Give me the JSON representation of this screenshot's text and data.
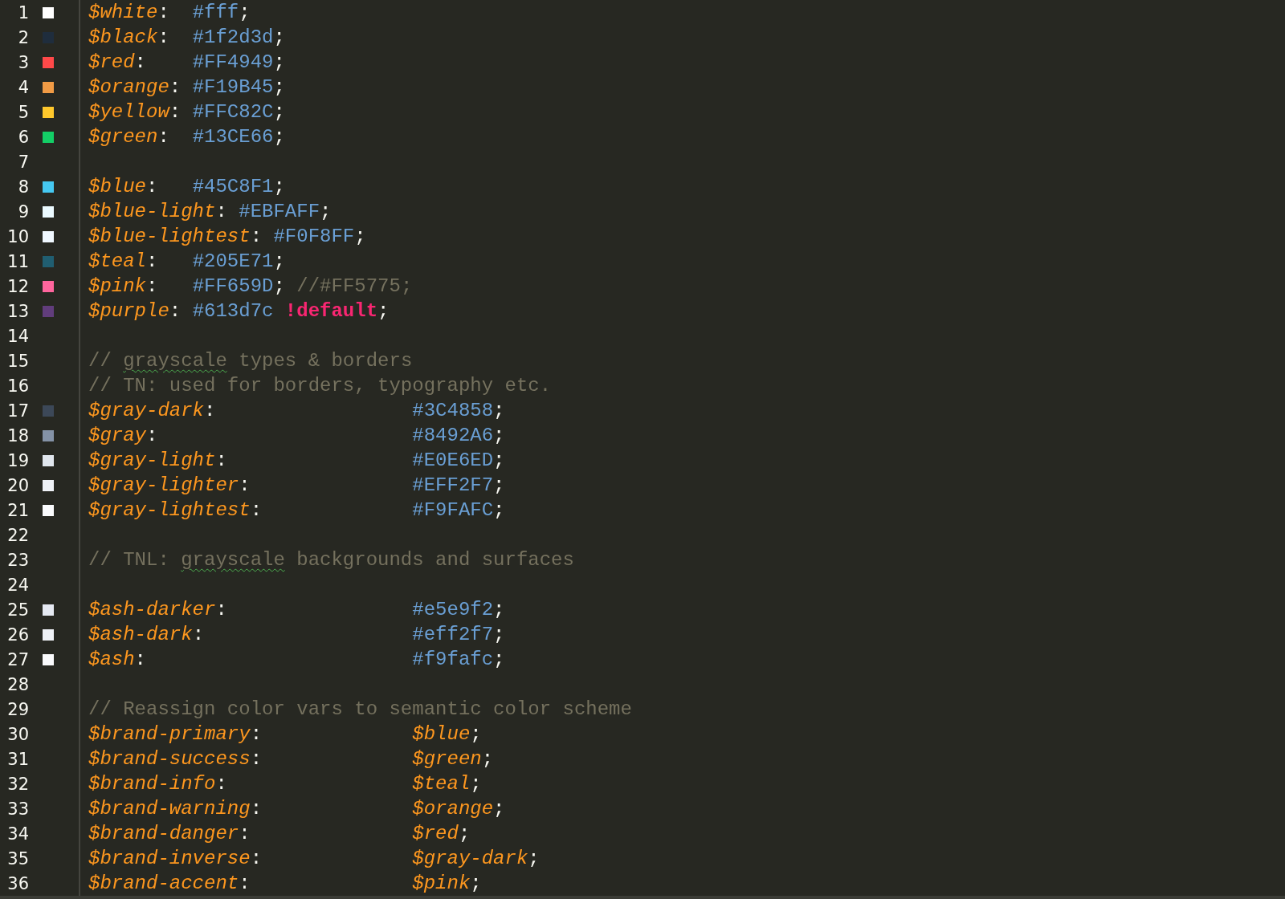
{
  "lines": [
    {
      "number": "1",
      "color": "#ffffff",
      "tokens": [
        {
          "kind": "var",
          "text": "$white"
        },
        {
          "kind": "punct",
          "text": ":  "
        },
        {
          "kind": "value",
          "text": "#fff"
        },
        {
          "kind": "punct",
          "text": ";"
        }
      ]
    },
    {
      "number": "2",
      "color": "#1f2d3d",
      "tokens": [
        {
          "kind": "var",
          "text": "$black"
        },
        {
          "kind": "punct",
          "text": ":  "
        },
        {
          "kind": "value",
          "text": "#1f2d3d"
        },
        {
          "kind": "punct",
          "text": ";"
        }
      ]
    },
    {
      "number": "3",
      "color": "#ff4949",
      "tokens": [
        {
          "kind": "var",
          "text": "$red"
        },
        {
          "kind": "punct",
          "text": ":    "
        },
        {
          "kind": "value",
          "text": "#FF4949"
        },
        {
          "kind": "punct",
          "text": ";"
        }
      ]
    },
    {
      "number": "4",
      "color": "#f19b45",
      "tokens": [
        {
          "kind": "var",
          "text": "$orange"
        },
        {
          "kind": "punct",
          "text": ": "
        },
        {
          "kind": "value",
          "text": "#F19B45"
        },
        {
          "kind": "punct",
          "text": ";"
        }
      ]
    },
    {
      "number": "5",
      "color": "#ffc82c",
      "tokens": [
        {
          "kind": "var",
          "text": "$yellow"
        },
        {
          "kind": "punct",
          "text": ": "
        },
        {
          "kind": "value",
          "text": "#FFC82C"
        },
        {
          "kind": "punct",
          "text": ";"
        }
      ]
    },
    {
      "number": "6",
      "color": "#13ce66",
      "tokens": [
        {
          "kind": "var",
          "text": "$green"
        },
        {
          "kind": "punct",
          "text": ":  "
        },
        {
          "kind": "value",
          "text": "#13CE66"
        },
        {
          "kind": "punct",
          "text": ";"
        }
      ]
    },
    {
      "number": "7"
    },
    {
      "number": "8",
      "color": "#45c8f1",
      "tokens": [
        {
          "kind": "var",
          "text": "$blue"
        },
        {
          "kind": "punct",
          "text": ":   "
        },
        {
          "kind": "value",
          "text": "#45C8F1"
        },
        {
          "kind": "punct",
          "text": ";"
        }
      ]
    },
    {
      "number": "9",
      "color": "#ebfaff",
      "tokens": [
        {
          "kind": "var",
          "text": "$blue-light"
        },
        {
          "kind": "punct",
          "text": ": "
        },
        {
          "kind": "value",
          "text": "#EBFAFF"
        },
        {
          "kind": "punct",
          "text": ";"
        }
      ]
    },
    {
      "number": "10",
      "color": "#f0f8ff",
      "tokens": [
        {
          "kind": "var",
          "text": "$blue-lightest"
        },
        {
          "kind": "punct",
          "text": ": "
        },
        {
          "kind": "value",
          "text": "#F0F8FF"
        },
        {
          "kind": "punct",
          "text": ";"
        }
      ]
    },
    {
      "number": "11",
      "color": "#205e71",
      "tokens": [
        {
          "kind": "var",
          "text": "$teal"
        },
        {
          "kind": "punct",
          "text": ":   "
        },
        {
          "kind": "value",
          "text": "#205E71"
        },
        {
          "kind": "punct",
          "text": ";"
        }
      ]
    },
    {
      "number": "12",
      "color": "#ff659d",
      "tokens": [
        {
          "kind": "var",
          "text": "$pink"
        },
        {
          "kind": "punct",
          "text": ":   "
        },
        {
          "kind": "value",
          "text": "#FF659D"
        },
        {
          "kind": "punct",
          "text": "; "
        },
        {
          "kind": "comment",
          "text": "//#FF5775;"
        }
      ]
    },
    {
      "number": "13",
      "color": "#613d7c",
      "tokens": [
        {
          "kind": "var",
          "text": "$purple"
        },
        {
          "kind": "punct",
          "text": ": "
        },
        {
          "kind": "value",
          "text": "#613d7c "
        },
        {
          "kind": "important",
          "text": "!default"
        },
        {
          "kind": "punct",
          "text": ";"
        }
      ]
    },
    {
      "number": "14"
    },
    {
      "number": "15",
      "tokens": [
        {
          "kind": "comment",
          "text": "// "
        },
        {
          "kind": "misspelled",
          "text": "grayscale"
        },
        {
          "kind": "comment",
          "text": " types & borders"
        }
      ]
    },
    {
      "number": "16",
      "tokens": [
        {
          "kind": "comment",
          "text": "// TN: used for borders, typography etc."
        }
      ]
    },
    {
      "number": "17",
      "color": "#3c4858",
      "tokens": [
        {
          "kind": "var",
          "text": "$gray-dark"
        },
        {
          "kind": "punct",
          "text": ":                 "
        },
        {
          "kind": "value",
          "text": "#3C4858"
        },
        {
          "kind": "punct",
          "text": ";"
        }
      ]
    },
    {
      "number": "18",
      "color": "#8492a6",
      "tokens": [
        {
          "kind": "var",
          "text": "$gray"
        },
        {
          "kind": "punct",
          "text": ":                      "
        },
        {
          "kind": "value",
          "text": "#8492A6"
        },
        {
          "kind": "punct",
          "text": ";"
        }
      ]
    },
    {
      "number": "19",
      "color": "#e0e6ed",
      "tokens": [
        {
          "kind": "var",
          "text": "$gray-light"
        },
        {
          "kind": "punct",
          "text": ":                "
        },
        {
          "kind": "value",
          "text": "#E0E6ED"
        },
        {
          "kind": "punct",
          "text": ";"
        }
      ]
    },
    {
      "number": "20",
      "color": "#eff2f7",
      "tokens": [
        {
          "kind": "var",
          "text": "$gray-lighter"
        },
        {
          "kind": "punct",
          "text": ":              "
        },
        {
          "kind": "value",
          "text": "#EFF2F7"
        },
        {
          "kind": "punct",
          "text": ";"
        }
      ]
    },
    {
      "number": "21",
      "color": "#f9fafc",
      "tokens": [
        {
          "kind": "var",
          "text": "$gray-lightest"
        },
        {
          "kind": "punct",
          "text": ":             "
        },
        {
          "kind": "value",
          "text": "#F9FAFC"
        },
        {
          "kind": "punct",
          "text": ";"
        }
      ]
    },
    {
      "number": "22"
    },
    {
      "number": "23",
      "tokens": [
        {
          "kind": "comment",
          "text": "// TNL: "
        },
        {
          "kind": "misspelled",
          "text": "grayscale"
        },
        {
          "kind": "comment",
          "text": " backgrounds and surfaces"
        }
      ]
    },
    {
      "number": "24"
    },
    {
      "number": "25",
      "color": "#e5e9f2",
      "tokens": [
        {
          "kind": "var",
          "text": "$ash-darker"
        },
        {
          "kind": "punct",
          "text": ":                "
        },
        {
          "kind": "value",
          "text": "#e5e9f2"
        },
        {
          "kind": "punct",
          "text": ";"
        }
      ]
    },
    {
      "number": "26",
      "color": "#eff2f7",
      "tokens": [
        {
          "kind": "var",
          "text": "$ash-dark"
        },
        {
          "kind": "punct",
          "text": ":                  "
        },
        {
          "kind": "value",
          "text": "#eff2f7"
        },
        {
          "kind": "punct",
          "text": ";"
        }
      ]
    },
    {
      "number": "27",
      "color": "#f9fafc",
      "tokens": [
        {
          "kind": "var",
          "text": "$ash"
        },
        {
          "kind": "punct",
          "text": ":                       "
        },
        {
          "kind": "value",
          "text": "#f9fafc"
        },
        {
          "kind": "punct",
          "text": ";"
        }
      ]
    },
    {
      "number": "28"
    },
    {
      "number": "29",
      "tokens": [
        {
          "kind": "comment",
          "text": "// Reassign color vars to semantic color scheme"
        }
      ]
    },
    {
      "number": "30",
      "tokens": [
        {
          "kind": "var",
          "text": "$brand-primary"
        },
        {
          "kind": "punct",
          "text": ":             "
        },
        {
          "kind": "var",
          "text": "$blue"
        },
        {
          "kind": "punct",
          "text": ";"
        }
      ]
    },
    {
      "number": "31",
      "tokens": [
        {
          "kind": "var",
          "text": "$brand-success"
        },
        {
          "kind": "punct",
          "text": ":             "
        },
        {
          "kind": "var",
          "text": "$green"
        },
        {
          "kind": "punct",
          "text": ";"
        }
      ]
    },
    {
      "number": "32",
      "tokens": [
        {
          "kind": "var",
          "text": "$brand-info"
        },
        {
          "kind": "punct",
          "text": ":                "
        },
        {
          "kind": "var",
          "text": "$teal"
        },
        {
          "kind": "punct",
          "text": ";"
        }
      ]
    },
    {
      "number": "33",
      "tokens": [
        {
          "kind": "var",
          "text": "$brand-warning"
        },
        {
          "kind": "punct",
          "text": ":             "
        },
        {
          "kind": "var",
          "text": "$orange"
        },
        {
          "kind": "punct",
          "text": ";"
        }
      ]
    },
    {
      "number": "34",
      "tokens": [
        {
          "kind": "var",
          "text": "$brand-danger"
        },
        {
          "kind": "punct",
          "text": ":              "
        },
        {
          "kind": "var",
          "text": "$red"
        },
        {
          "kind": "punct",
          "text": ";"
        }
      ]
    },
    {
      "number": "35",
      "tokens": [
        {
          "kind": "var",
          "text": "$brand-inverse"
        },
        {
          "kind": "punct",
          "text": ":             "
        },
        {
          "kind": "var",
          "text": "$gray-dark"
        },
        {
          "kind": "punct",
          "text": ";"
        }
      ]
    },
    {
      "number": "36",
      "tokens": [
        {
          "kind": "var",
          "text": "$brand-accent"
        },
        {
          "kind": "punct",
          "text": ":              "
        },
        {
          "kind": "var",
          "text": "$pink"
        },
        {
          "kind": "punct",
          "text": ";"
        }
      ]
    }
  ]
}
